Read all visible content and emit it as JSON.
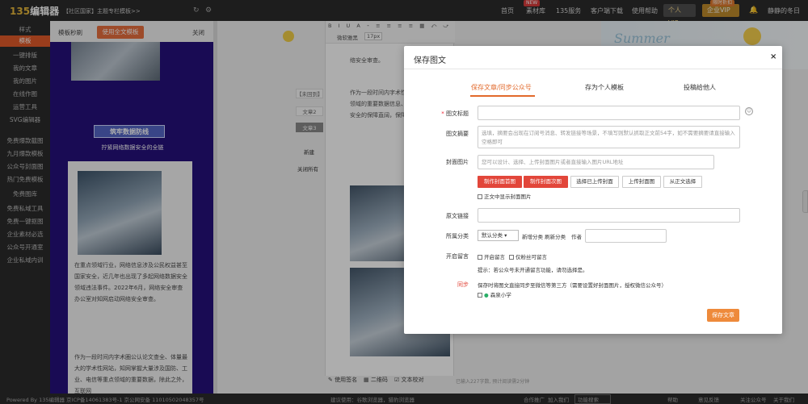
{
  "app": {
    "logo_num": "135",
    "logo_text": "编辑器",
    "breadcrumb": "【社区国家】主题专栏模板>>"
  },
  "topnav": {
    "items": [
      "首页",
      "素材库",
      "135服务",
      "客户端下载",
      "使用帮助"
    ],
    "badge_hot": "NEW",
    "badge_new": "限时折扣",
    "vip_personal": "个人VIP",
    "vip_biz": "企业VIP",
    "user": "静静的冬日"
  },
  "sidebar": {
    "items": [
      "样式",
      "模板",
      "一键排版",
      "我的文章",
      "我的图片",
      "在线作图",
      "运营工具",
      "SVG编辑器",
      "免费爆款截图",
      "九月爆款模板",
      "公众号封面图",
      "热门免费模板",
      "免费图库",
      "免费私域工具",
      "免费一键抠图",
      "企业素材必选",
      "公众号开通室",
      "企业私域内训"
    ],
    "active_index": 1
  },
  "template_panel": {
    "title": "模板秒刷",
    "use_button": "使用全文模板",
    "close": "关闭",
    "headline": "筑牢数据防线",
    "subtitle": "拧紧网络数据安全的全链",
    "para1": "在重点领域行业，网络信息涉及公民权益甚至国家安全，近几年也出现了多起网络数据安全领域违法事件。2022年6月，网络安全审查办公室对知网启动网络安全审查。",
    "para2": "作为一段时间内字术圈公认论文查全、体量最大的学术性网站，知网掌握大量涉及国防、工业、电信等重点领域的重要数据，除此之外，互联网"
  },
  "mid_panel": {
    "items": [
      "【未回到】",
      "文章2",
      "文章3"
    ],
    "selected_index": 2,
    "new_label": "新建",
    "close_all": "关闭所有"
  },
  "editor": {
    "font_select": "微软雅黑",
    "font_size": "17px",
    "text1": "络安全审查。",
    "text2": "作为一段时间内字术性网站，知网掌点领域的重要数据信息、大数据资产数据安全的保障直阔，保障网络数据",
    "bottom": [
      "使用签名",
      "二维码",
      "文本校对"
    ],
    "stat": "已输入227字数, 预计阅读需2分钟"
  },
  "banner": {
    "text": "Summer"
  },
  "footer": {
    "left": "Powered By 135编辑器  京ICP备14061383号-1 京公网安备 11010502048357号",
    "mid": "建议使用：谷歌浏览器，猎豹浏览器",
    "links": [
      "合作推广",
      "加入我们",
      "功能搜索",
      "帮助",
      "意见反馈",
      "关注公众号",
      "关于我们"
    ]
  },
  "modal": {
    "title": "保存图文",
    "close": "×",
    "tabs": [
      "保存文章/同步公众号",
      "存为个人模板",
      "投稿给他人"
    ],
    "active_tab": 0,
    "fields": {
      "title_label": "图文标题",
      "title_value": "",
      "summary_label": "图文摘要",
      "summary_placeholder": "选填，摘要会出现在订阅号消息、转发链接等场景，不填写则默认抓取正文前54字，如不需要摘要请直接输入空格即可",
      "cover_label": "封面图片",
      "cover_placeholder": "您可以设计、选择、上传封面图片或者直接输入图片URL地址",
      "cover_buttons": [
        "制作封面首图",
        "制作封面次图",
        "选择已上传封面",
        "上传封面图",
        "从正文选择"
      ],
      "show_cover": "正文中显示封面图片",
      "link_label": "原文链接",
      "link_value": "",
      "category_label": "所属分类",
      "category_value": "默认分类",
      "category_links": "新增分类 刷新分类",
      "author_label": "作者",
      "comment_label": "开启留言",
      "comment_open": "开启留言",
      "comment_fans": "仅粉丝可留言",
      "comment_hint": "提示：若公众号未开通留言功能，请勿选择是。",
      "sync_label": "同步",
      "sync_text": "保存时将图文直接同步至微信等第三方（需要设置好封面图片，授权微信公众号）",
      "sync_account": "森泉小学",
      "save_button": "保存文章"
    }
  }
}
